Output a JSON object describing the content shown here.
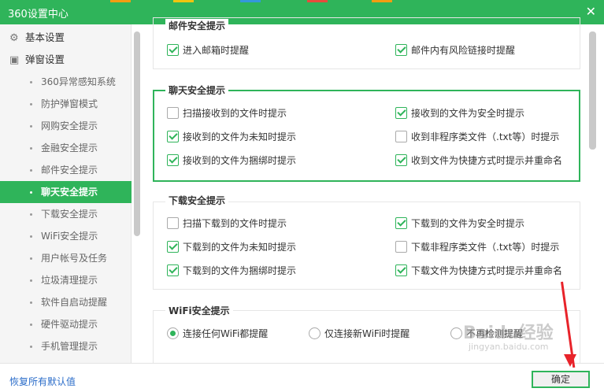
{
  "window": {
    "title": "360设置中心",
    "close_label": "✕"
  },
  "colors": {
    "accent": "#2fb45a",
    "link": "#2a6cc9",
    "annotation": "#e8232a"
  },
  "sidebar": {
    "groups": [
      {
        "label": "基本设置",
        "icon": "gear-icon"
      },
      {
        "label": "弹窗设置",
        "icon": "window-icon"
      }
    ],
    "items": [
      {
        "label": "360异常感知系统"
      },
      {
        "label": "防护弹窗模式"
      },
      {
        "label": "网购安全提示"
      },
      {
        "label": "金融安全提示"
      },
      {
        "label": "邮件安全提示"
      },
      {
        "label": "聊天安全提示",
        "active": true
      },
      {
        "label": "下载安全提示"
      },
      {
        "label": "WiFi安全提示"
      },
      {
        "label": "用户帐号及任务"
      },
      {
        "label": "垃圾清理提示"
      },
      {
        "label": "软件自启动提醒"
      },
      {
        "label": "硬件驱动提示"
      },
      {
        "label": "手机管理提示"
      }
    ]
  },
  "sections": {
    "mail": {
      "title": "邮件安全提示",
      "options": [
        {
          "label": "进入邮箱时提醒",
          "checked": true
        },
        {
          "label": "邮件内有风险链接时提醒",
          "checked": true
        }
      ]
    },
    "chat": {
      "title": "聊天安全提示",
      "options": [
        {
          "label": "扫描接收到的文件时提示",
          "checked": false
        },
        {
          "label": "接收到的文件为安全时提示",
          "checked": true
        },
        {
          "label": "接收到的文件为未知时提示",
          "checked": true
        },
        {
          "label": "收到非程序类文件（.txt等）时提示",
          "checked": false
        },
        {
          "label": "接收到的文件为捆绑时提示",
          "checked": true
        },
        {
          "label": "收到文件为快捷方式时提示并重命名",
          "checked": true
        }
      ]
    },
    "download": {
      "title": "下载安全提示",
      "options": [
        {
          "label": "扫描下载到的文件时提示",
          "checked": false
        },
        {
          "label": "下载到的文件为安全时提示",
          "checked": true
        },
        {
          "label": "下载到的文件为未知时提示",
          "checked": true
        },
        {
          "label": "下载非程序类文件（.txt等）时提示",
          "checked": false
        },
        {
          "label": "下载到的文件为捆绑时提示",
          "checked": true
        },
        {
          "label": "下载文件为快捷方式时提示并重命名",
          "checked": true
        }
      ]
    },
    "wifi": {
      "title": "WiFi安全提示",
      "options": [
        {
          "label": "连接任何WiFi都提醒",
          "checked": true
        },
        {
          "label": "仅连接新WiFi时提醒",
          "checked": false
        },
        {
          "label": "不再检测提醒",
          "checked": false
        }
      ]
    }
  },
  "footer": {
    "restore_label": "恢复所有默认值",
    "ok_label": "确定"
  },
  "watermark": {
    "text": "Baidu经验",
    "sub": "jingyan.baidu.com"
  }
}
